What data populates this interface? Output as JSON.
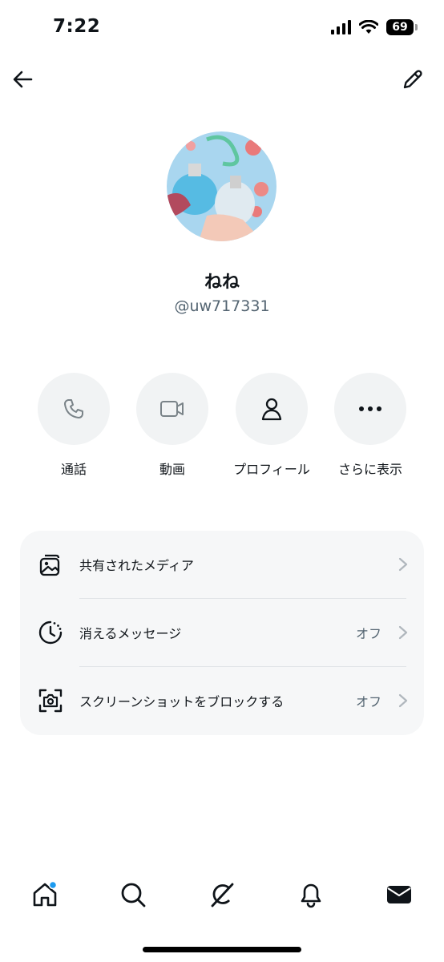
{
  "status_bar": {
    "time": "7:22",
    "battery": "69"
  },
  "profile": {
    "name": "ねね",
    "handle": "@uw717331"
  },
  "actions": [
    {
      "label": "通話",
      "icon": "phone-icon"
    },
    {
      "label": "動画",
      "icon": "video-camera-icon"
    },
    {
      "label": "プロフィール",
      "icon": "person-icon"
    },
    {
      "label": "さらに表示",
      "icon": "more-dots-icon"
    }
  ],
  "settings": [
    {
      "label": "共有されたメディア",
      "value": "",
      "icon": "media-gallery-icon"
    },
    {
      "label": "消えるメッセージ",
      "value": "オフ",
      "icon": "timer-icon"
    },
    {
      "label": "スクリーンショットをブロックする",
      "value": "オフ",
      "icon": "screenshot-block-icon"
    }
  ],
  "tabbar": [
    "home-icon",
    "search-icon",
    "grok-icon",
    "bell-icon",
    "mail-icon"
  ],
  "colors": {
    "notification_dot": "#1d9bf0",
    "secondary_text": "#536471",
    "card_bg": "#f6f7f8"
  }
}
